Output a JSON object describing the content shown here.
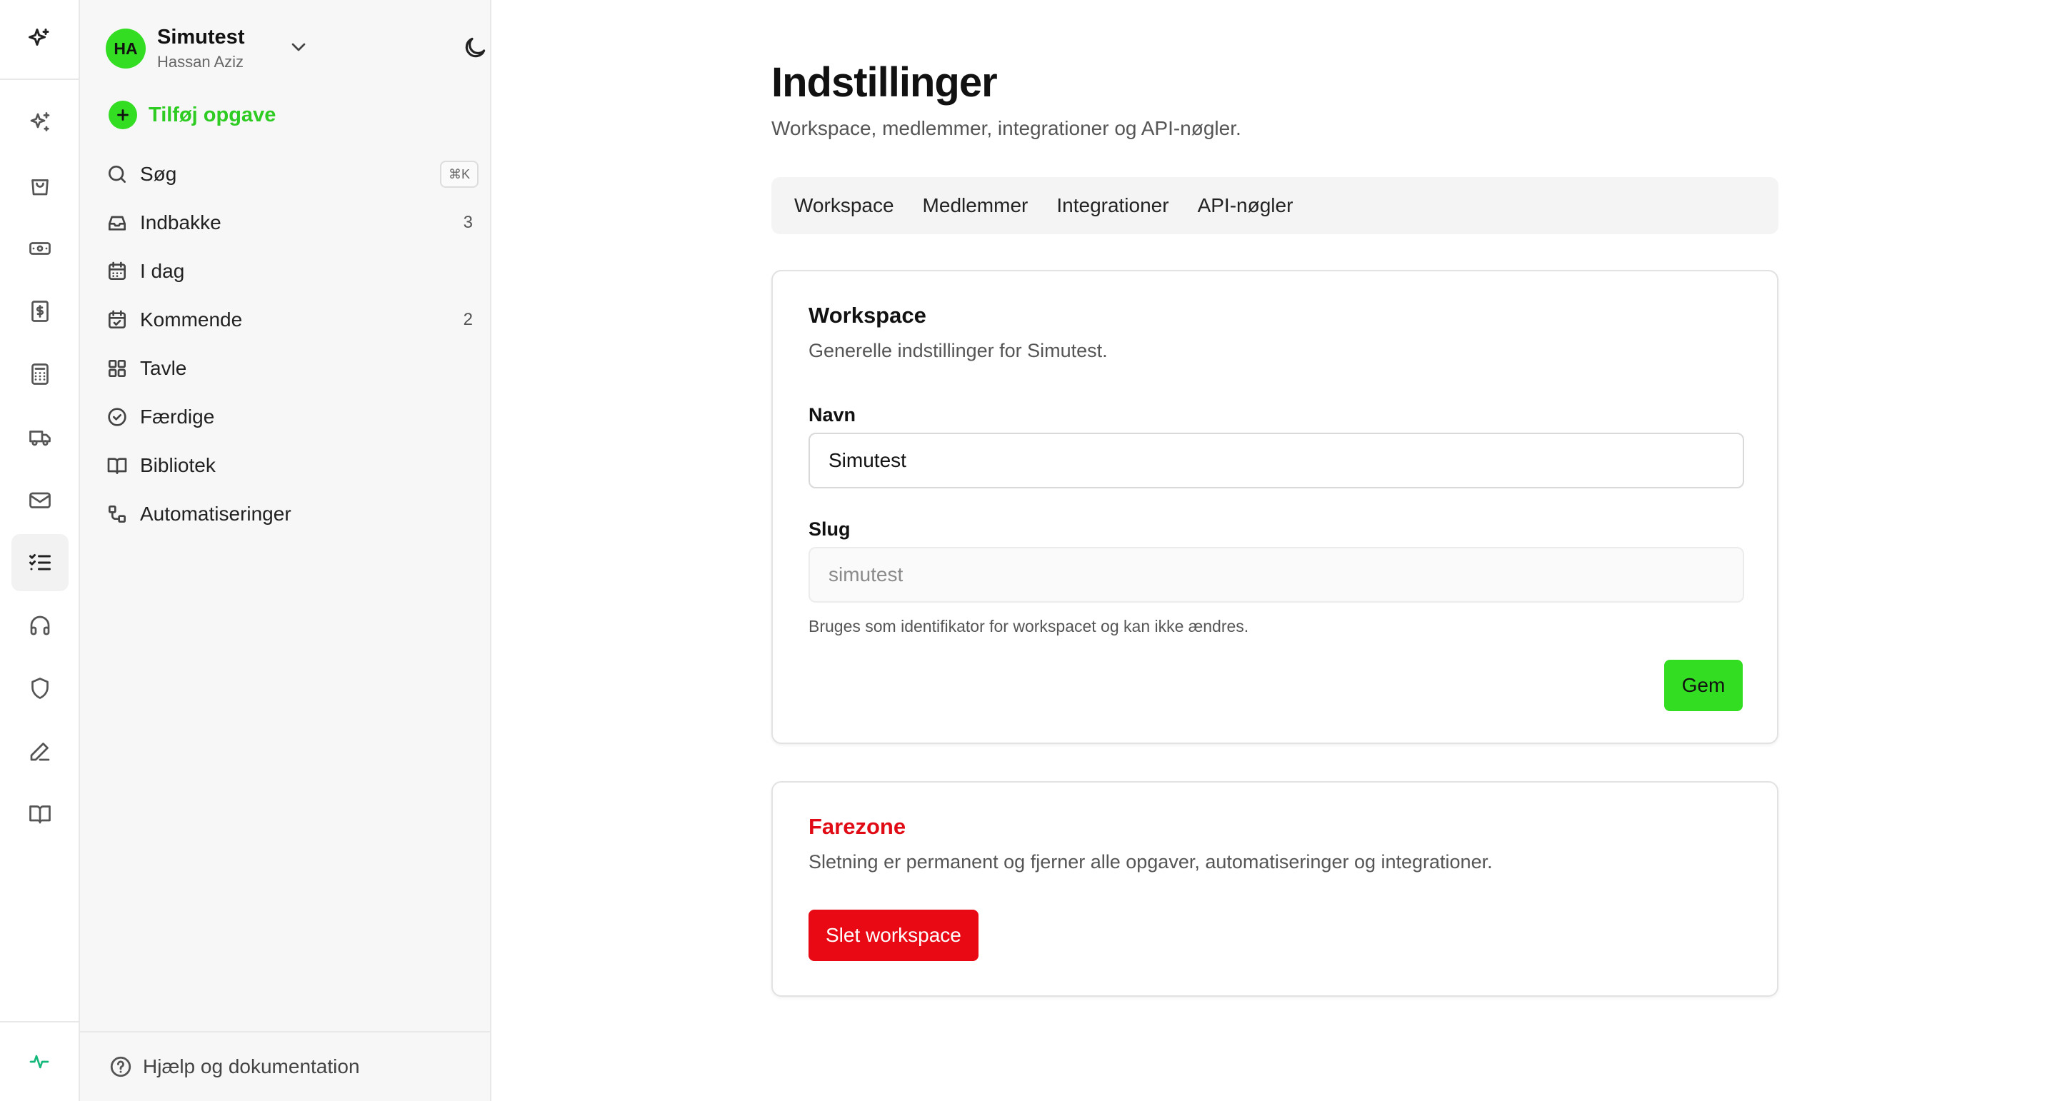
{
  "workspace": {
    "initials": "HA",
    "name": "Simutest",
    "user": "Hassan Aziz"
  },
  "sidebar": {
    "add_task": "Tilføj opgave",
    "items": [
      {
        "label": "Søg",
        "icon": "search-icon",
        "shortcut": "⌘K"
      },
      {
        "label": "Indbakke",
        "icon": "inbox-icon",
        "count": "3"
      },
      {
        "label": "I dag",
        "icon": "calendar-icon"
      },
      {
        "label": "Kommende",
        "icon": "calendar-check-icon",
        "count": "2"
      },
      {
        "label": "Tavle",
        "icon": "grid-icon"
      },
      {
        "label": "Færdige",
        "icon": "check-circle-icon"
      },
      {
        "label": "Bibliotek",
        "icon": "book-icon"
      },
      {
        "label": "Automatiseringer",
        "icon": "workflow-icon"
      }
    ],
    "help": "Hjælp og dokumentation"
  },
  "rail": {
    "icons": [
      "sparkles-icon",
      "shopping-bag-icon",
      "banknote-icon",
      "receipt-icon",
      "calculator-icon",
      "truck-icon",
      "mail-icon",
      "tasks-icon",
      "headphones-icon",
      "shield-icon",
      "pen-icon",
      "book-open-icon"
    ],
    "active": "tasks-icon",
    "bottom": "activity-icon"
  },
  "page": {
    "title": "Indstillinger",
    "subtitle": "Workspace, medlemmer, integrationer og API-nøgler.",
    "tabs": [
      "Workspace",
      "Medlemmer",
      "Integrationer",
      "API-nøgler"
    ]
  },
  "workspace_card": {
    "title": "Workspace",
    "description": "Generelle indstillinger for Simutest.",
    "name_label": "Navn",
    "name_value": "Simutest",
    "slug_label": "Slug",
    "slug_value": "simutest",
    "slug_hint": "Bruges som identifikator for workspacet og kan ikke ændres.",
    "save": "Gem"
  },
  "danger_card": {
    "title": "Farezone",
    "description": "Sletning er permanent og fjerner alle opgaver, automatiseringer og integrationer.",
    "delete": "Slet workspace"
  },
  "colors": {
    "accent": "#33dd22",
    "danger": "#e80914"
  }
}
